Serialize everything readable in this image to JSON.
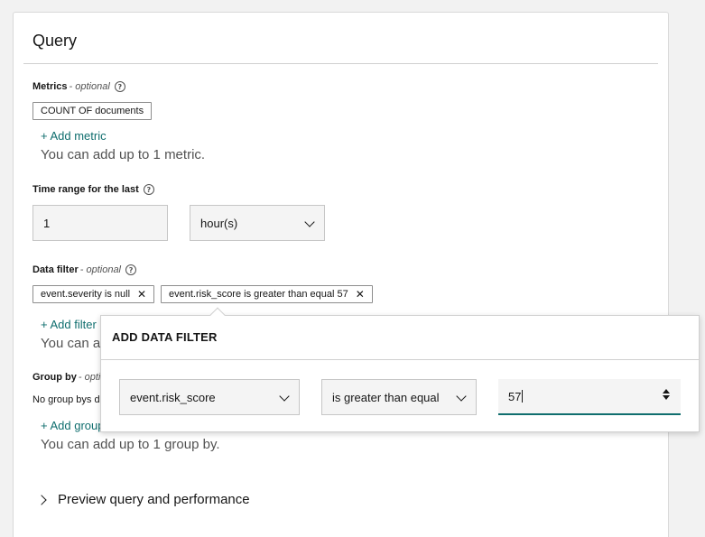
{
  "query": {
    "title": "Query"
  },
  "metrics": {
    "label": "Metrics",
    "optional": "- optional",
    "tag": "COUNT OF documents",
    "add_link": "+ Add metric",
    "hint": "You can add up to 1 metric."
  },
  "time_range": {
    "label": "Time range for the last",
    "value": "1",
    "unit": "hour(s)"
  },
  "data_filter": {
    "label": "Data filter",
    "optional": "- optional",
    "tags": [
      "event.severity is null",
      "event.risk_score is greater than equal 57"
    ],
    "add_link": "+ Add filter",
    "hint_partial": "You can ad"
  },
  "group_by": {
    "label": "Group by",
    "optional": "- opti",
    "none_text": "No group bys d",
    "add_link": "+ Add group",
    "hint": "You can add up to 1 group by."
  },
  "preview": {
    "label": "Preview query and performance"
  },
  "popover": {
    "title": "ADD DATA FILTER",
    "field_value": "event.risk_score",
    "operator_value": "is greater than equal",
    "input_value": "57"
  },
  "icons": {
    "help": "help-circle-icon",
    "close": "close-icon",
    "chevron_down": "chevron-down-icon",
    "chevron_right": "chevron-right-icon",
    "stepper": "number-stepper-icon"
  },
  "colors": {
    "link": "#0f6e6e",
    "focus": "#0f6e6e"
  }
}
